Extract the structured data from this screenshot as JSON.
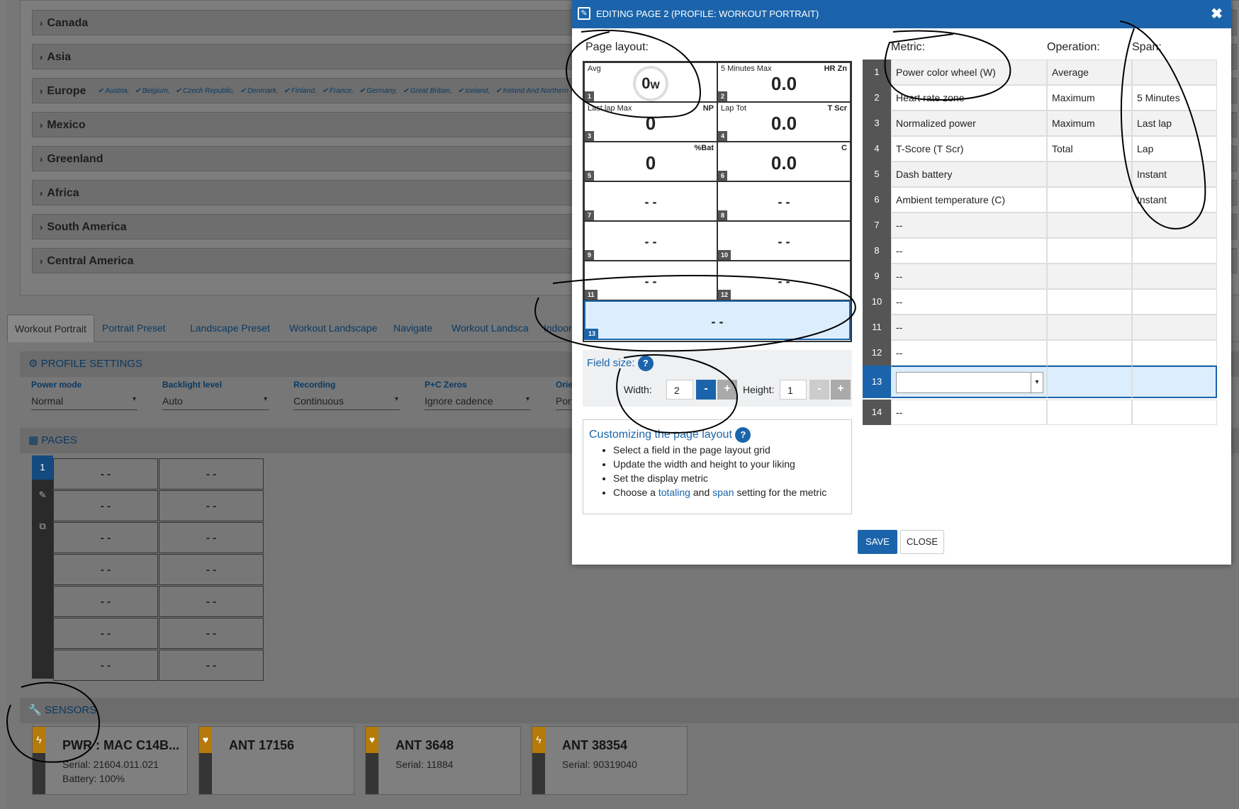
{
  "regions": [
    {
      "name": "Canada"
    },
    {
      "name": "Asia"
    },
    {
      "name": "Europe",
      "countries": [
        "Austria,",
        "Belgium,",
        "Czech Republic,",
        "Denmark,",
        "Finland,",
        "France,",
        "Germany,",
        "Great Britain,",
        "Iceland,",
        "Ireland And Northern Ireland,"
      ]
    },
    {
      "name": "Mexico"
    },
    {
      "name": "Greenland"
    },
    {
      "name": "Africa"
    },
    {
      "name": "South America"
    },
    {
      "name": "Central America"
    }
  ],
  "tabs": [
    "Workout Portrait",
    "Portrait Preset",
    "Landscape Preset",
    "Workout Landscape",
    "Navigate",
    "Workout Landsca",
    "Indoor"
  ],
  "profile_settings": {
    "title": "PROFILE SETTINGS",
    "items": [
      {
        "label": "Power mode",
        "value": "Normal"
      },
      {
        "label": "Backlight level",
        "value": "Auto"
      },
      {
        "label": "Recording",
        "value": "Continuous"
      },
      {
        "label": "P+C Zeros",
        "value": "Ignore cadence"
      },
      {
        "label": "Orie",
        "value": "Por"
      }
    ]
  },
  "pages": {
    "title": "PAGES",
    "page_number": "1",
    "cell_value": "- -"
  },
  "sensors": {
    "title": "SENSORS",
    "items": [
      {
        "name": "PWR : MAC C14B...",
        "serial": "Serial: 21604.011.021",
        "battery": "Battery: 100%",
        "icon": "bolt-icon",
        "color": "#b47a0a"
      },
      {
        "name": "ANT 17156",
        "serial": "",
        "battery": "",
        "icon": "heart-icon",
        "color": "#b47a0a"
      },
      {
        "name": "ANT 3648",
        "serial": "Serial: 11884",
        "battery": "",
        "icon": "heart-icon",
        "color": "#b47a0a"
      },
      {
        "name": "ANT 38354",
        "serial": "Serial: 90319040",
        "battery": "",
        "icon": "bolt-icon",
        "color": "#b47a0a"
      }
    ]
  },
  "modal": {
    "title": "EDITING PAGE 2 (PROFILE: WORKOUT PORTRAIT)",
    "close_glyph": "✖",
    "page_layout_label": "Page layout:",
    "metric_label": "Metric:",
    "operation_label": "Operation:",
    "span_label": "Span:",
    "fields": [
      {
        "num": "1",
        "name": "Avg",
        "abbr": "",
        "value": "0",
        "unit": "W",
        "gauge": true
      },
      {
        "num": "2",
        "name": "5 Minutes Max",
        "abbr": "HR Zn",
        "value": "0.0"
      },
      {
        "num": "3",
        "name": "Last lap Max",
        "abbr": "NP",
        "value": "0"
      },
      {
        "num": "4",
        "name": "Lap Tot",
        "abbr": "T Scr",
        "value": "0.0"
      },
      {
        "num": "5",
        "name": "",
        "abbr": "%Bat",
        "value": "0"
      },
      {
        "num": "6",
        "name": "",
        "abbr": "C",
        "value": "0.0"
      },
      {
        "num": "7",
        "name": "",
        "abbr": "",
        "value": "- -"
      },
      {
        "num": "8",
        "name": "",
        "abbr": "",
        "value": "- -"
      },
      {
        "num": "9",
        "name": "",
        "abbr": "",
        "value": "- -"
      },
      {
        "num": "10",
        "name": "",
        "abbr": "",
        "value": "- -"
      },
      {
        "num": "11",
        "name": "",
        "abbr": "",
        "value": "- -"
      },
      {
        "num": "12",
        "name": "",
        "abbr": "",
        "value": "- -"
      },
      {
        "num": "13",
        "name": "",
        "abbr": "",
        "value": "- -"
      }
    ],
    "field_size": {
      "label": "Field size:",
      "help": "?",
      "width_label": "Width:",
      "width_value": "2",
      "height_label": "Height:",
      "height_value": "1",
      "minus": "-",
      "plus": "+"
    },
    "help_box": {
      "title": "Customizing the page layout",
      "help": "?",
      "items": [
        "Select a field in the page layout grid",
        "Update the width and height to your liking",
        "Set the display metric"
      ],
      "last_item_pre": "Choose a",
      "last_item_link1": "totaling",
      "last_item_mid": "and",
      "last_item_link2": "span",
      "last_item_post": "setting for the metric"
    },
    "metrics": [
      {
        "num": "1",
        "metric": "Power color wheel (W)",
        "operation": "Average",
        "span": ""
      },
      {
        "num": "2",
        "metric": "Heart rate zone",
        "operation": "Maximum",
        "span": "5 Minutes"
      },
      {
        "num": "3",
        "metric": "Normalized power",
        "operation": "Maximum",
        "span": "Last lap"
      },
      {
        "num": "4",
        "metric": "T-Score (T Scr)",
        "operation": "Total",
        "span": "Lap"
      },
      {
        "num": "5",
        "metric": "Dash battery",
        "operation": "",
        "span": "Instant"
      },
      {
        "num": "6",
        "metric": "Ambient temperature (C)",
        "operation": "",
        "span": "Instant"
      },
      {
        "num": "7",
        "metric": "--",
        "operation": "",
        "span": ""
      },
      {
        "num": "8",
        "metric": "--",
        "operation": "",
        "span": ""
      },
      {
        "num": "9",
        "metric": "--",
        "operation": "",
        "span": ""
      },
      {
        "num": "10",
        "metric": "--",
        "operation": "",
        "span": ""
      },
      {
        "num": "11",
        "metric": "--",
        "operation": "",
        "span": ""
      },
      {
        "num": "12",
        "metric": "--",
        "operation": "",
        "span": ""
      },
      {
        "num": "13",
        "metric": "",
        "operation": "",
        "span": "",
        "selected": true
      },
      {
        "num": "14",
        "metric": "--",
        "operation": "",
        "span": ""
      }
    ],
    "save_label": "SAVE",
    "close_label": "CLOSE"
  },
  "colors": {
    "accent": "#1b64ab",
    "sensor_bar": "#b47a0a"
  }
}
